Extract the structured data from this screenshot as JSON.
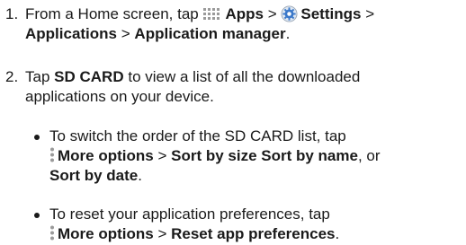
{
  "step1": {
    "number": "1.",
    "prefix": "From a Home screen, tap",
    "apps": "Apps",
    "sep1": ">",
    "settings": "Settings",
    "sep2": ">",
    "applications": "Applications",
    "sep3": ">",
    "app_manager": "Application manager",
    "end": "."
  },
  "step2": {
    "number": "2.",
    "tap": "Tap",
    "sd_card": "SD CARD",
    "line1_rest": "to view a list of all the downloaded",
    "line2": "applications on your device."
  },
  "bullet1": {
    "line1": "To switch the order of the SD CARD list, tap",
    "more_options": "More options",
    "sep": ">",
    "sort_size_name": "Sort by size Sort by name",
    "or": ", or",
    "sort_date": "Sort by date",
    "end": "."
  },
  "bullet2": {
    "line1": "To reset your application preferences, tap",
    "more_options": "More options",
    "sep": ">",
    "reset": "Reset app preferences",
    "end": "."
  },
  "icons": {
    "apps": "apps-grid-icon",
    "settings": "settings-gear-icon",
    "more": "more-options-icon"
  },
  "colors": {
    "text": "#1a1a1a",
    "icon_gray": "#9a9a9a",
    "gear_blue": "#3a78c9"
  }
}
